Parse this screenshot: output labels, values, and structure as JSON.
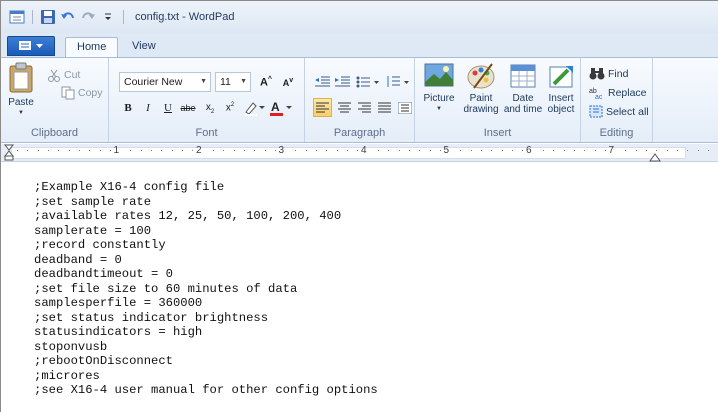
{
  "window": {
    "title": "config.txt - WordPad"
  },
  "tabs": {
    "home": "Home",
    "view": "View"
  },
  "clipboard": {
    "label": "Clipboard",
    "paste": "Paste",
    "cut": "Cut",
    "copy": "Copy"
  },
  "font": {
    "label": "Font",
    "family": "Courier New",
    "size": "11"
  },
  "paragraph": {
    "label": "Paragraph"
  },
  "insert": {
    "label": "Insert",
    "picture": "Picture",
    "paint_drawing": "Paint drawing",
    "date_time": "Date and time",
    "insert_object": "Insert object"
  },
  "editing": {
    "label": "Editing",
    "find": "Find",
    "replace": "Replace",
    "select_all": "Select all"
  },
  "ruler": {
    "marks": [
      "1",
      "2",
      "3",
      "4",
      "5",
      "6",
      "7"
    ]
  },
  "document": {
    "lines": [
      ";Example X16-4 config file",
      ";set sample rate",
      ";available rates 12, 25, 50, 100, 200, 400",
      "samplerate = 100",
      ";record constantly",
      "deadband = 0",
      "deadbandtimeout = 0",
      ";set file size to 60 minutes of data",
      "samplesperfile = 360000",
      ";set status indicator brightness",
      "statusindicators = high",
      "stoponvusb",
      ";rebootOnDisconnect",
      ";microres",
      ";see X16-4 user manual for other config options"
    ]
  }
}
